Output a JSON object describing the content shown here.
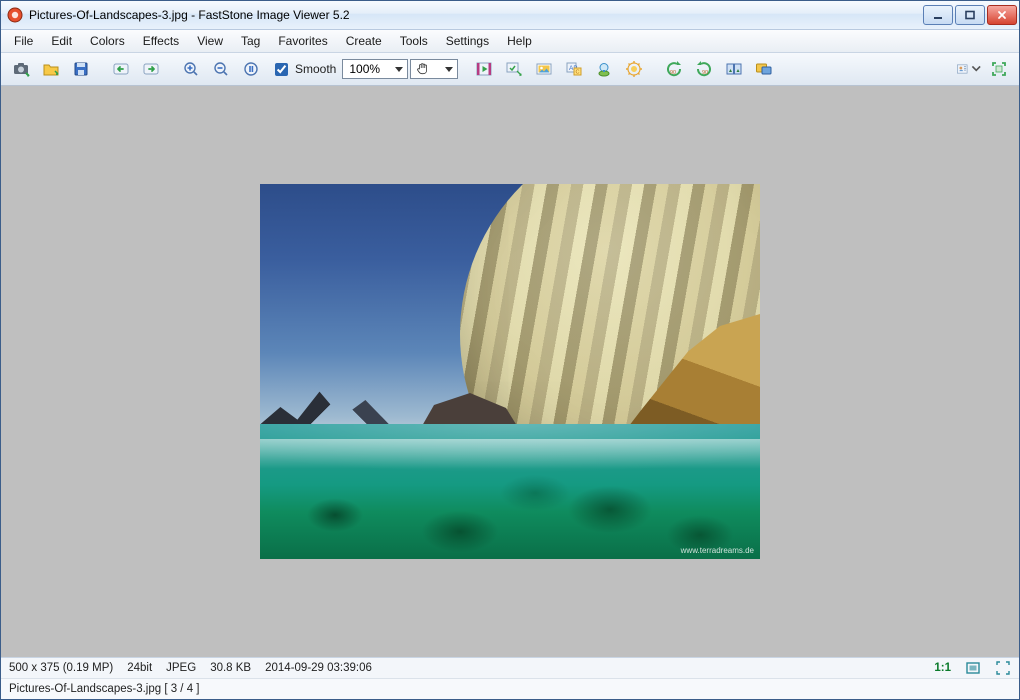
{
  "title": "Pictures-Of-Landscapes-3.jpg  -  FastStone Image Viewer 5.2",
  "menu": [
    "File",
    "Edit",
    "Colors",
    "Effects",
    "View",
    "Tag",
    "Favorites",
    "Create",
    "Tools",
    "Settings",
    "Help"
  ],
  "toolbar": {
    "smooth_label": "Smooth",
    "smooth_checked": true,
    "zoom_value": "100%"
  },
  "image": {
    "watermark": "www.terradreams.de"
  },
  "status1": {
    "dimensions": "500 x 375 (0.19 MP)",
    "depth": "24bit",
    "format": "JPEG",
    "filesize": "30.8 KB",
    "datetime": "2014-09-29 03:39:06",
    "ratio": "1:1"
  },
  "status2": {
    "text": "Pictures-Of-Landscapes-3.jpg [ 3 / 4 ]"
  }
}
